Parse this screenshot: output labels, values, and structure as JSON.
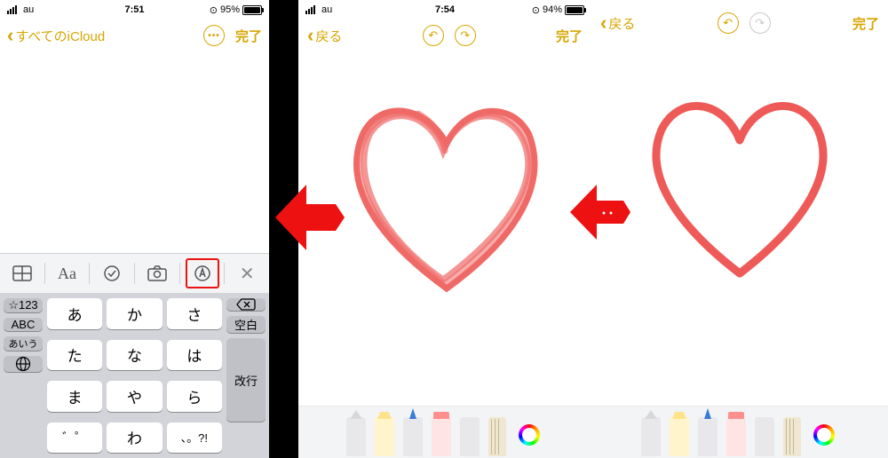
{
  "panel1": {
    "status": {
      "carrier": "au",
      "time": "7:51",
      "battery_pct": "95%",
      "battery_level": 0.95
    },
    "nav": {
      "back_label": "すべてのiCloud",
      "done": "完了"
    },
    "toolbar": {
      "items": [
        "table",
        "format",
        "checklist",
        "camera",
        "markup",
        "close"
      ]
    },
    "keyboard": {
      "rows": [
        {
          "side": "☆123",
          "keys": [
            "あ",
            "か",
            "さ"
          ],
          "right": "backspace"
        },
        {
          "side": "ABC",
          "keys": [
            "た",
            "な",
            "は"
          ],
          "right": "空白"
        },
        {
          "side": "あいう",
          "keys": [
            "ま",
            "や",
            "ら"
          ],
          "right": "改行"
        },
        {
          "side": "globe",
          "keys": [
            "゛゜",
            "わ",
            "、。?!"
          ],
          "right": ""
        }
      ]
    }
  },
  "panel2": {
    "status": {
      "carrier": "au",
      "time": "7:54",
      "battery_pct": "94%",
      "battery_level": 0.94
    },
    "nav": {
      "back_label": "戻る",
      "done": "完了"
    },
    "heart_style": "sketchy",
    "tools": [
      "pen",
      "highlighter",
      "pencil",
      "eraser",
      "lasso",
      "ruler",
      "color"
    ]
  },
  "panel3": {
    "nav": {
      "back_label": "戻る",
      "done": "完了"
    },
    "heart_style": "clean",
    "tools": [
      "pen",
      "highlighter",
      "pencil",
      "eraser",
      "lasso",
      "ruler",
      "color"
    ]
  },
  "colors": {
    "accent": "#d7a500",
    "heart": "#ee5a57"
  }
}
